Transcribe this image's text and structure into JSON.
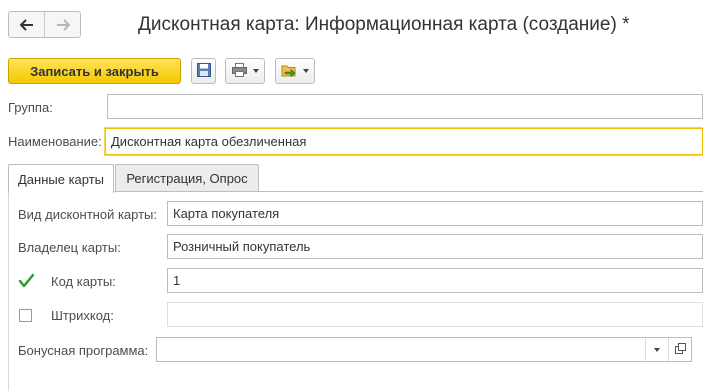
{
  "window": {
    "title": "Дисконтная карта: Информационная карта (создание) *"
  },
  "nav": {
    "back_icon": "arrow-left-icon",
    "forward_icon": "arrow-right-icon"
  },
  "toolbar": {
    "save_close_label": "Записать и закрыть",
    "save_icon": "floppy-disk-icon",
    "print_icon": "printer-icon",
    "create_based_icon": "create-based-on-icon"
  },
  "form": {
    "group_label": "Группа:",
    "group_value": "",
    "name_label": "Наименование:",
    "name_value": "Дисконтная карта обезличенная"
  },
  "tabs": [
    {
      "label": "Данные карты",
      "active": true
    },
    {
      "label": "Регистрация, Опрос",
      "active": false
    }
  ],
  "card": {
    "kind_label": "Вид дисконтной карты:",
    "kind_value": "Карта покупателя",
    "owner_label": "Владелец карты:",
    "owner_value": "Розничный покупатель",
    "code_label": "Код карты:",
    "code_checked": true,
    "code_value": "1",
    "barcode_label": "Штрихкод:",
    "barcode_checked": false,
    "barcode_value": "",
    "bonus_label": "Бонусная программа:",
    "bonus_value": ""
  },
  "colors": {
    "accent_yellow": "#f4c800",
    "focus_border": "#f2c200",
    "check_green": "#2e9a2e"
  }
}
